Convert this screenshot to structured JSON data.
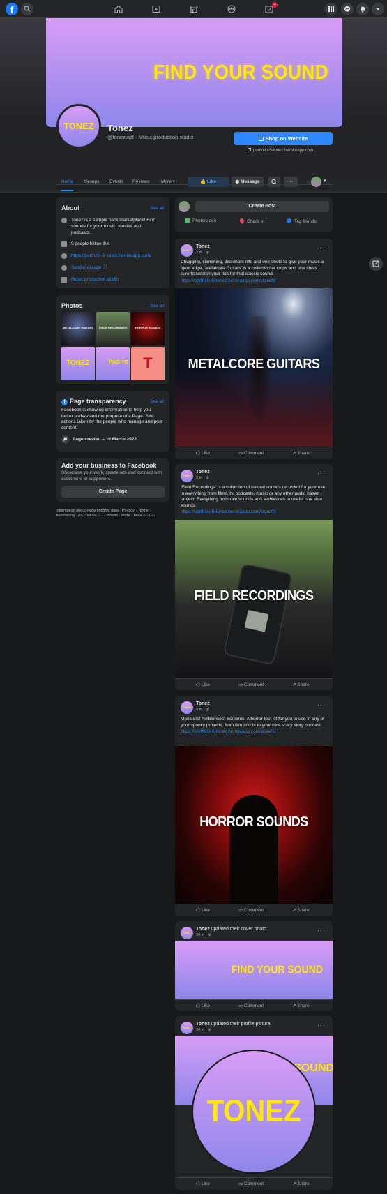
{
  "nav": {
    "logo": "f",
    "notification_count": "4"
  },
  "cover": {
    "text": "FIND YOUR SOUND"
  },
  "profile": {
    "avatar_text": "TONEZ",
    "name": "Tonez",
    "subtitle": "@tonez.aiff · Music production studio",
    "shop_button": "Shop on Website",
    "shop_url": "portfolio-5-tonez.herokuapp.com"
  },
  "tabs": [
    "Home",
    "Groups",
    "Events",
    "Reviews",
    "More"
  ],
  "actions": {
    "like": "Like",
    "message": "Message"
  },
  "about": {
    "title": "About",
    "see_all": "See all",
    "description": "Tonez is a sample pack marketplace! Find sounds for your music, movies and podcasts.",
    "followers": "0 people follow this",
    "website": "https://portfolio-5-tonez.herokuapp.com/",
    "send_message": "Send message",
    "category": "Music production studio"
  },
  "photos": {
    "title": "Photos",
    "see_all": "See all",
    "items": [
      "METALCORE GUITARS",
      "FIELD RECORDINGS",
      "HORROR SOUNDS",
      "TONEZ",
      "FIND YO",
      "T"
    ]
  },
  "transparency": {
    "title": "Page transparency",
    "see_all": "See all",
    "text": "Facebook is showing information to help you better understand the purpose of a Page. See actions taken by the people who manage and post content.",
    "created": "Page created – 16 March 2022"
  },
  "add_business": {
    "title": "Add your business to Facebook",
    "text": "Showcase your work, create ads and connect with customers or supporters.",
    "button": "Create Page"
  },
  "footer": {
    "line1": "Information about Page Insights data · Privacy · Terms ·",
    "line2": "Advertising · Ad choices ▷ · Cookies · More · Meta © 2022"
  },
  "composer": {
    "create_post": "Create Post",
    "photo_video": "Photo/video",
    "check_in": "Check in",
    "tag_friends": "Tag friends"
  },
  "posts": [
    {
      "author": "Tonez",
      "time": "3 m · ",
      "text": "Chugging, slamming, dissonant riffs and one shots to give your music a djent edge. 'Metalcore Guitars' is a collection of loops and one shots sure to scratch your itch for that classic sound.",
      "link": "https://portfolio-5-tonez.herokuapp.com/store/3/",
      "image_title": "METALCORE GUITARS"
    },
    {
      "author": "Tonez",
      "time": "3 m · ",
      "text": "'Field Recordings' is a collection of natural sounds recorded for your use in everything from films, tv, podcasts, music or any other audio based project. Everything from rain sounds and ambiences to useful one shot sounds.",
      "link": "https://portfolio-5-tonez.herokuapp.com/store/2/",
      "image_title": "FIELD RECORDINGS"
    },
    {
      "author": "Tonez",
      "time": "4 m · ",
      "text": "Monsters! Ambiences! Screams! A horror tool kit for you to use in any of your spooky projects, from film and tv to your new scary story podcast.",
      "link": "https://portfolio-5-tonez.herokuapp.com/store/1/",
      "image_title": "HORROR SOUNDS"
    },
    {
      "author": "Tonez",
      "action": " updated their cover photo.",
      "time": "34 m · ",
      "image_title": "FIND YOUR SOUND"
    },
    {
      "author": "Tonez",
      "action": " updated their profile picture.",
      "time": "34 m · ",
      "image_title": "TONEZ",
      "image_sub": "SOUND"
    }
  ],
  "post_actions": {
    "like": "Like",
    "comment": "Comment",
    "share": "Share"
  },
  "colors": {
    "accent": "#2d88ff",
    "card": "#242526",
    "bg": "#18191a",
    "brand_yellow": "#ffe60f",
    "brand_purple": "#d79cf5"
  }
}
